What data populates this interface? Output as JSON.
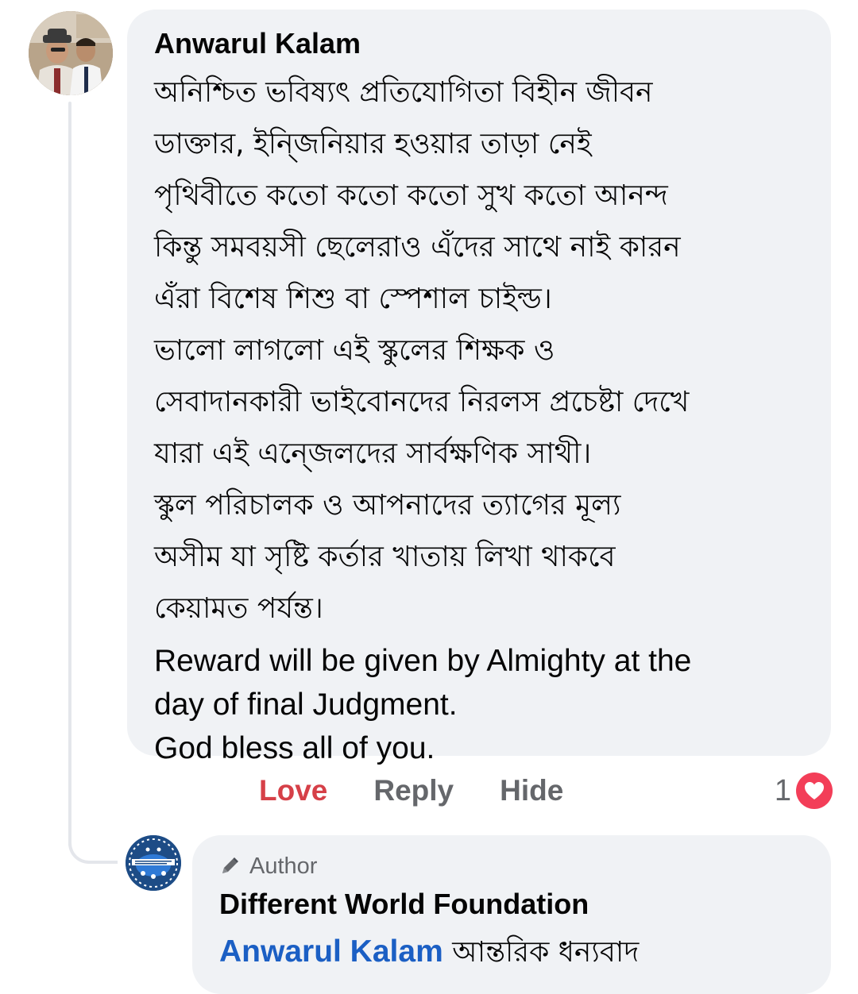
{
  "comment": {
    "author": "Anwarul Kalam",
    "lines_bn": [
      "অনিশ্চিত ভবিষ্যৎ প্রতিযোগিতা বিহীন জীবন",
      "ডাক্তার, ইন্জিনিয়ার হওয়ার তাড়া নেই",
      "পৃথিবীতে কতো কতো কতো সুখ কতো আনন্দ",
      "কিন্তু সমবয়সী ছেলেরাও এঁদের সাথে নাই কারন",
      "এঁরা বিশেষ শিশু বা স্পেশাল চাইল্ড।",
      "ভালো লাগলো এই স্কুলের শিক্ষক ও",
      "সেবাদানকারী ভাইবোনদের নিরলস প্রচেষ্টা দেখে",
      "যারা এই এন্জেলদের সার্বক্ষণিক সাথী।",
      "স্কুল পরিচালক ও আপনাদের ত্যাগের মূল্য",
      "অসীম যা সৃষ্টি কর্তার খাতায় লিখা থাকবে",
      "কেয়ামত পর্যন্ত।"
    ],
    "lines_en": [
      "Reward will be given by Almighty at the",
      "day of final Judgment.",
      "God bless all of you."
    ],
    "actions": {
      "love": "Love",
      "reply": "Reply",
      "hide": "Hide"
    },
    "reaction_count": "1",
    "reaction_icon": "heart-icon",
    "colors": {
      "love": "#d64048",
      "heart_badge": "#f33e58",
      "mention": "#1b5fc4",
      "bubble": "#f0f2f5"
    }
  },
  "reply": {
    "badge_label": "Author",
    "badge_icon": "pencil-icon",
    "author": "Different World Foundation",
    "mention": "Anwarul Kalam",
    "text": "আন্তরিক ধন্যবাদ"
  }
}
